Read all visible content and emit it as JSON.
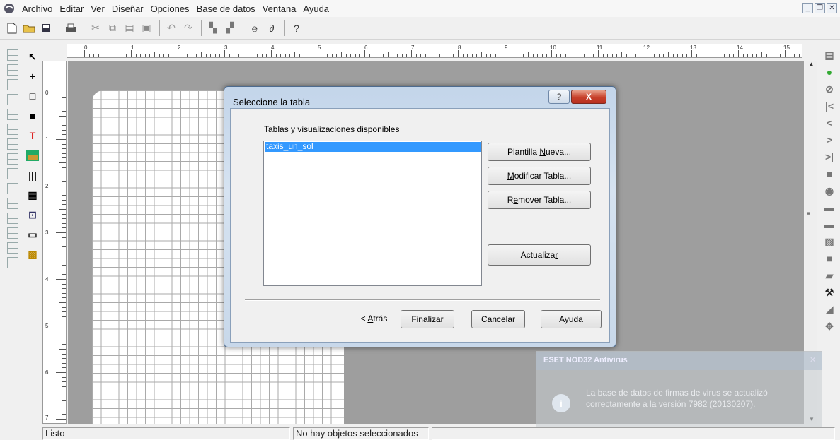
{
  "menu": {
    "items": [
      "Archivo",
      "Editar",
      "Ver",
      "Diseñar",
      "Opciones",
      "Base de datos",
      "Ventana",
      "Ayuda"
    ]
  },
  "window_controls": {
    "minimize": "_",
    "restore": "❐",
    "close": "✕"
  },
  "toolbar": {
    "icons": [
      "new-file-icon",
      "open-folder-icon",
      "save-icon",
      "print-icon",
      "cut-icon",
      "copy-icon",
      "paste-icon",
      "paste-special-icon",
      "undo-icon",
      "redo-icon",
      "bring-front-icon",
      "send-back-icon",
      "link-icon",
      "unlink-icon",
      "help-icon"
    ]
  },
  "ruler": {
    "h_labels": [
      "0",
      "1",
      "2",
      "3",
      "4",
      "5",
      "6",
      "7",
      "8",
      "9",
      "10",
      "11",
      "12",
      "13",
      "14",
      "15"
    ],
    "v_labels": [
      "0",
      "1",
      "2",
      "3",
      "4",
      "5",
      "6",
      "7"
    ]
  },
  "dialog": {
    "title": "Seleccione la tabla",
    "help_glyph": "?",
    "close_glyph": "X",
    "list_label": "Tablas y visualizaciones disponibles",
    "list_items": [
      "taxis_un_sol"
    ],
    "buttons": {
      "new_template_pre": "Plantilla ",
      "new_template_ul": "N",
      "new_template_post": "ueva...",
      "modify_pre": "",
      "modify_ul": "M",
      "modify_post": "odificar Tabla...",
      "remove_pre": "R",
      "remove_ul": "e",
      "remove_post": "mover Tabla...",
      "refresh_pre": "Actualiza",
      "refresh_ul": "r",
      "refresh_post": "",
      "back_pre": "< ",
      "back_ul": "A",
      "back_post": "trás",
      "finish": "Finalizar",
      "cancel": "Cancelar",
      "help": "Ayuda"
    }
  },
  "notification": {
    "title": "ESET NOD32 Antivirus",
    "close": "✕",
    "icon_glyph": "i",
    "message": "La base de datos de firmas de virus se actualizó correctamente a la versión 7982 (20130207)."
  },
  "status": {
    "left": "Listo",
    "middle": "No hay objetos seleccionados"
  }
}
